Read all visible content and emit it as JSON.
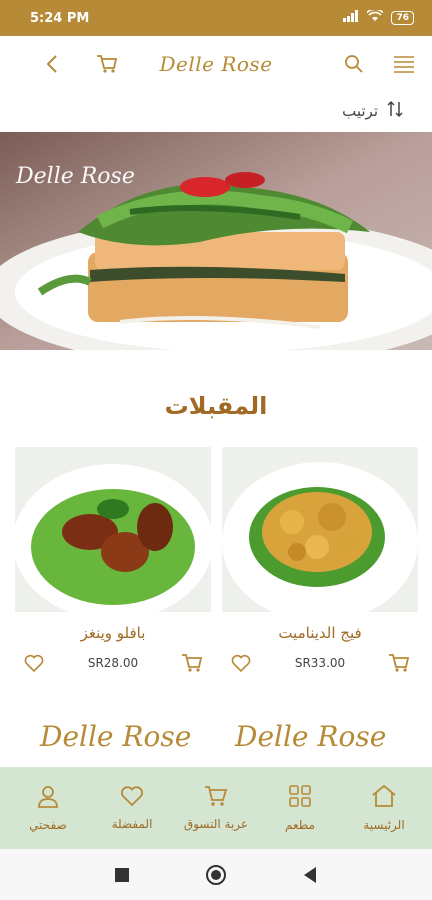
{
  "status_bar": {
    "time": "5:24 PM",
    "battery": "76"
  },
  "header": {
    "logo_text": "Delle Rose",
    "icons": [
      "back-icon",
      "cart-icon",
      "search-icon",
      "menu-icon"
    ]
  },
  "sort": {
    "label": "ترتيب"
  },
  "banner": {
    "watermark": "Delle Rose"
  },
  "section": {
    "title": "المقبلات"
  },
  "products": [
    {
      "name": "فيج الديناميت",
      "price": "SR33.00"
    },
    {
      "name": "بافلو وينغز",
      "price": "SR28.00"
    }
  ],
  "brand_strip": {
    "text_1": "Delle Rose",
    "text_2": "Delle Rose"
  },
  "bottom_nav": [
    {
      "label": "الرئيسية",
      "icon": "home-icon"
    },
    {
      "label": "مطعم",
      "icon": "grid-icon"
    },
    {
      "label": "عربة التسوق",
      "icon": "cart-icon"
    },
    {
      "label": "المفضلة",
      "icon": "heart-icon"
    },
    {
      "label": "صفحتي",
      "icon": "user-icon"
    }
  ],
  "colors": {
    "accent": "#b78a37",
    "nav_bg": "#d4e6d2",
    "title": "#a06a25"
  }
}
